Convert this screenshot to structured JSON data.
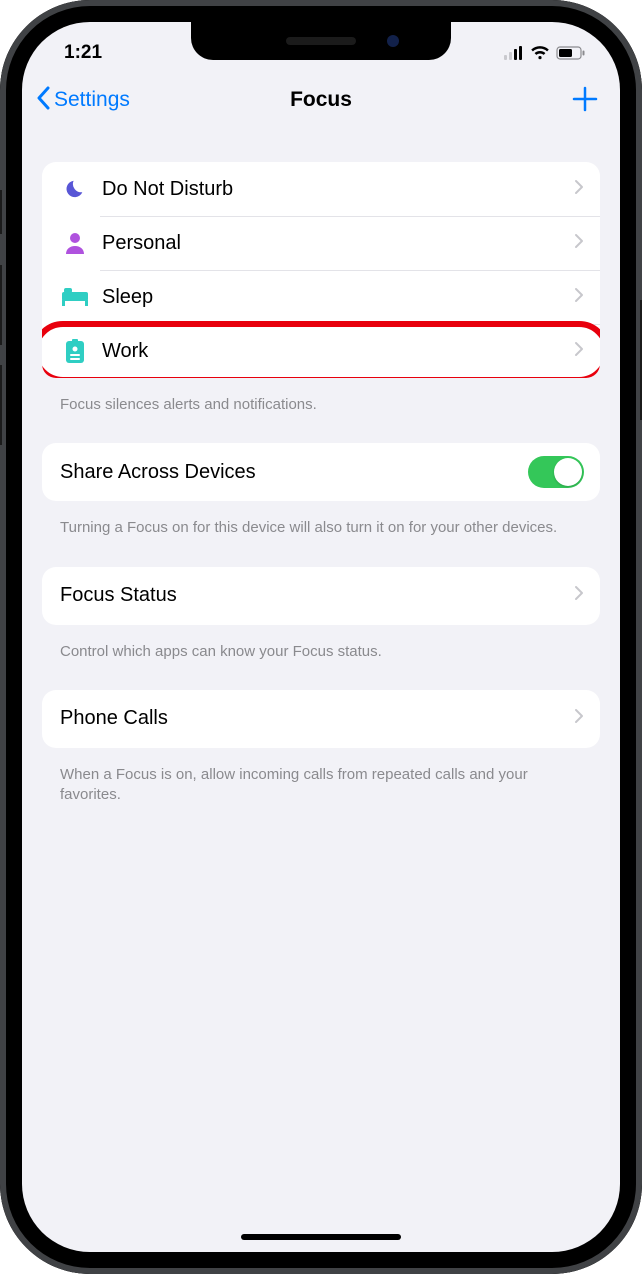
{
  "status": {
    "time": "1:21"
  },
  "nav": {
    "back_label": "Settings",
    "title": "Focus"
  },
  "focus_modes": {
    "items": [
      {
        "label": "Do Not Disturb",
        "icon": "moon",
        "color": "#5856d6"
      },
      {
        "label": "Personal",
        "icon": "person",
        "color": "#af52de"
      },
      {
        "label": "Sleep",
        "icon": "bed",
        "color": "#2fcec3"
      },
      {
        "label": "Work",
        "icon": "badge",
        "color": "#2fcec3"
      }
    ],
    "footer": "Focus silences alerts and notifications."
  },
  "share": {
    "label": "Share Across Devices",
    "enabled": true,
    "footer": "Turning a Focus on for this device will also turn it on for your other devices."
  },
  "focus_status": {
    "label": "Focus Status",
    "footer": "Control which apps can know your Focus status."
  },
  "phone_calls": {
    "label": "Phone Calls",
    "footer": "When a Focus is on, allow incoming calls from repeated calls and your favorites."
  },
  "highlight_index": 3
}
